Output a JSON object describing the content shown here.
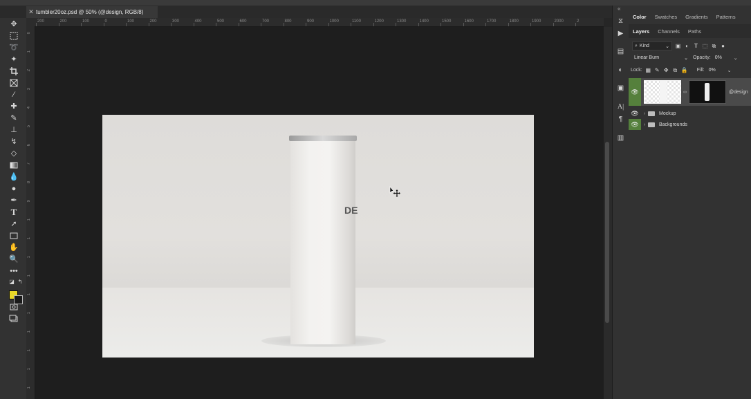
{
  "document": {
    "tab_title": "tumbler20oz.psd @ 50% (@design, RGB/8)",
    "close_label": "✕"
  },
  "rulers": {
    "top_ticks": [
      "200",
      "200",
      "100",
      "0",
      "100",
      "200",
      "300",
      "400",
      "500",
      "600",
      "700",
      "800",
      "900",
      "1000",
      "1100",
      "1200",
      "1300",
      "1400",
      "1500",
      "1600",
      "1700",
      "1800",
      "1900",
      "2000",
      "2"
    ],
    "left_ticks": [
      "0",
      "1",
      "2",
      "3",
      "4",
      "5",
      "6",
      "7",
      "8",
      "9",
      "1",
      "1",
      "1",
      "1",
      "1",
      "1",
      "1",
      "1",
      "1",
      "1"
    ]
  },
  "canvas": {
    "print_text": "DE",
    "colors": {
      "background": "#dedcd9",
      "floor": "#ececea",
      "tumbler": "#f3f2f0"
    }
  },
  "toolbar": {
    "foreground_color": "#e8d728",
    "background_color": "#1a1a1a",
    "tools": [
      "move-icon",
      "marquee-icon",
      "lasso-icon",
      "magic-wand-icon",
      "crop-icon",
      "frame-icon",
      "eyedropper-icon",
      "healing-brush-icon",
      "brush-icon",
      "clone-stamp-icon",
      "history-brush-icon",
      "eraser-icon",
      "gradient-icon",
      "blur-icon",
      "dodge-icon",
      "pen-icon",
      "type-icon",
      "path-select-icon",
      "rectangle-icon",
      "hand-icon",
      "zoom-icon",
      "more-icon"
    ]
  },
  "panel_top": {
    "tabs": [
      "Color",
      "Swatches",
      "Gradients",
      "Patterns"
    ],
    "active": "Color"
  },
  "layers_panel": {
    "tabs": [
      "Layers",
      "Channels",
      "Paths"
    ],
    "active": "Layers",
    "filter_label": "Kind",
    "blend_mode": "Linear Burn",
    "opacity_label": "Opacity:",
    "opacity_value": "0%",
    "lock_label": "Lock:",
    "fill_label": "Fill:",
    "fill_value": "0%",
    "layers": [
      {
        "name": "@design",
        "visible": true,
        "selected": true
      },
      {
        "name": "Mockup",
        "visible": true,
        "type": "group"
      },
      {
        "name": "Backgrounds",
        "visible": true,
        "type": "group"
      }
    ]
  },
  "collapse": {
    "left": "»",
    "right": "«"
  }
}
